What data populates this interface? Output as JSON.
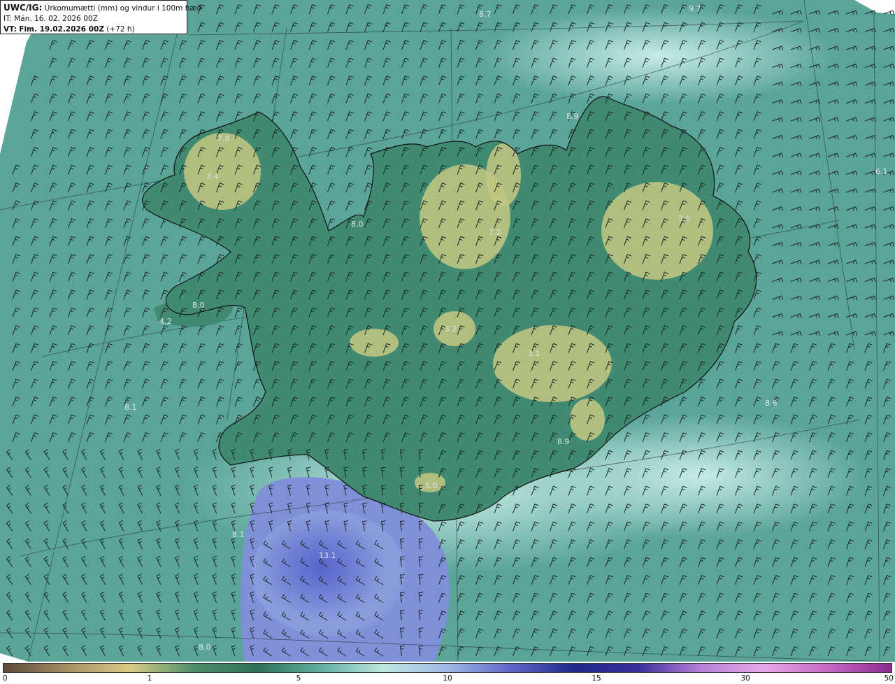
{
  "header": {
    "code": "UWC/IG:",
    "title": "Úrkomumætti (mm) og vindur i 100m hæð",
    "init_label": "IT:",
    "init_time": "Mán. 16. 02. 2026 00Z",
    "valid_label": "VT:",
    "valid_time": "Fim. 19.02.2026 00Z",
    "lead": "(+72 h)"
  },
  "colorbar": {
    "ticks": [
      "0",
      "1",
      "5",
      "10",
      "15",
      "30",
      "50"
    ],
    "stops": [
      "#5b4a3a",
      "#a68f64",
      "#d8cc84",
      "#4d8f6a",
      "#2e7058",
      "#5fb0a2",
      "#bde7e2",
      "#9fb7e6",
      "#5e66c8",
      "#1d2a8a",
      "#3a2f9c",
      "#b87fd9",
      "#e7a8e8",
      "#c667c4",
      "#8a2a8e"
    ]
  },
  "map": {
    "colors": {
      "sea": "#5aa49a",
      "coast_light": "#9fd6d0",
      "land": "#3f8a70",
      "highland": "#c4c783",
      "heavy": "#7f90d8",
      "heaviest": "#5e6ad0",
      "coastline": "#111111"
    },
    "labels": [
      "8.7",
      "9.7",
      "8.9",
      "7.8",
      "3.4",
      "8.0",
      "7.2",
      "3.0",
      "6.1",
      "8.0",
      "4.2",
      "3.2",
      "3.1",
      "8.1",
      "8.6",
      "8.9",
      "5.0",
      "8.1",
      "13.1",
      "8.0"
    ]
  }
}
